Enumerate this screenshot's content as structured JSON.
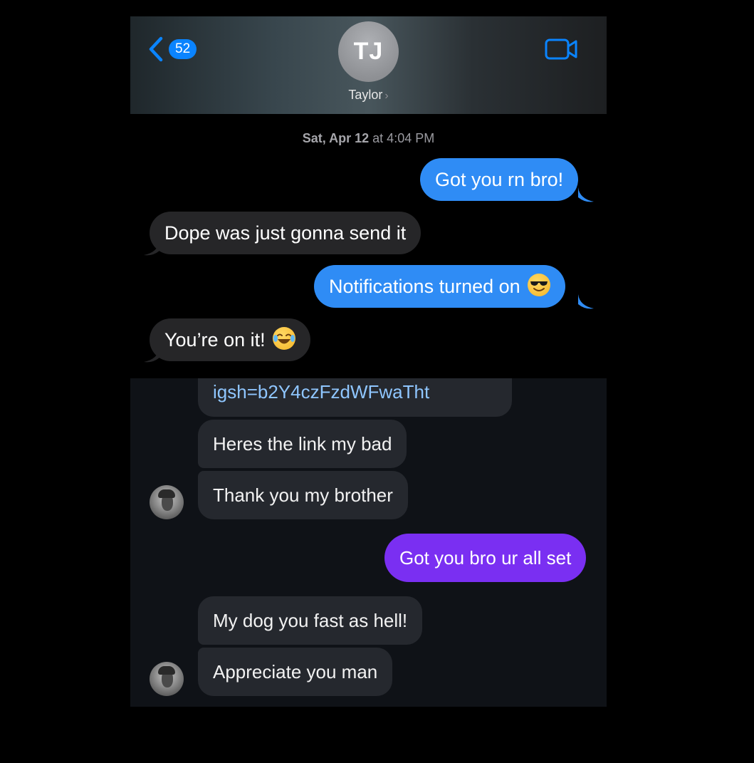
{
  "imessage": {
    "header": {
      "back_count": "52",
      "avatar_initials": "TJ",
      "contact_name": "Taylor"
    },
    "timestamp": {
      "day": "Sat, Apr 12",
      "at": "at 4:04 PM"
    },
    "messages": [
      {
        "direction": "outgoing",
        "text": "Got you rn bro!"
      },
      {
        "direction": "incoming",
        "text": "Dope was just gonna send it"
      },
      {
        "direction": "outgoing",
        "text": "Notifications turned on",
        "emoji": "smiling-face-with-sunglasses"
      },
      {
        "direction": "incoming",
        "text": "You’re on it!",
        "emoji": "face-with-tears-of-joy"
      }
    ],
    "colors": {
      "outgoing_bubble": "#2f8cf5",
      "incoming_bubble": "#262628",
      "accent": "#0a84ff"
    }
  },
  "instagram_dm": {
    "messages": [
      {
        "direction": "incoming",
        "text": "igsh=b2Y4czFzdWFwaTht",
        "is_link": true
      },
      {
        "direction": "incoming",
        "text": "Heres the link my bad"
      },
      {
        "direction": "incoming",
        "text": "Thank you my brother"
      },
      {
        "direction": "outgoing",
        "text": "Got you bro ur all set"
      },
      {
        "direction": "incoming",
        "text": "My dog you fast as hell!"
      },
      {
        "direction": "incoming",
        "text": "Appreciate you man"
      }
    ],
    "colors": {
      "background": "#0f1217",
      "incoming_bubble": "#25282e",
      "outgoing_bubble": "#7a2ff2",
      "link": "#8fc6ff"
    }
  }
}
